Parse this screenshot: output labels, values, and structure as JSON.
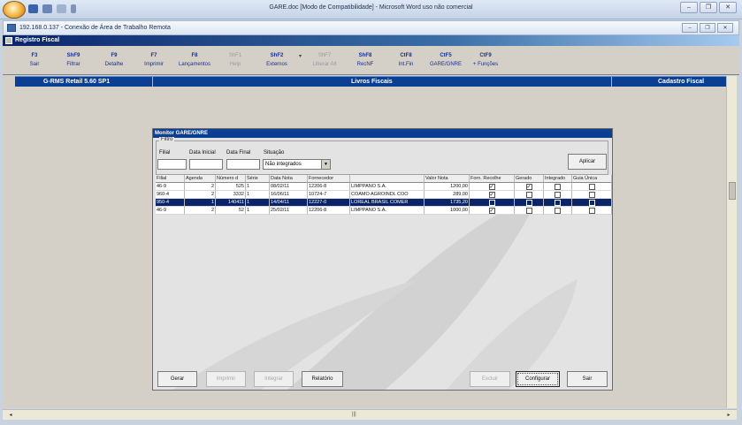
{
  "word": {
    "title": "GARE.doc [Modo de Compatibilidade] - Microsoft Word uso não comercial"
  },
  "rdp": {
    "title": "192.168.0.137 - Conexão de Área de Trabalho Remota"
  },
  "app": {
    "title": "Registro Fiscal"
  },
  "toolbar": {
    "items": [
      {
        "key": "F3",
        "label": "Sair",
        "enabled": true
      },
      {
        "key": "ShF9",
        "label": "Filtrar",
        "enabled": true
      },
      {
        "key": "F9",
        "label": "Detalhe",
        "enabled": true
      },
      {
        "key": "F7",
        "label": "Imprimir",
        "enabled": true
      },
      {
        "key": "F8",
        "label": "Lançamentos",
        "enabled": true
      },
      {
        "key": "ShF1",
        "label": "Help",
        "enabled": false
      },
      {
        "key": "ShF2",
        "label": "Externos",
        "enabled": true
      },
      {
        "key": "ShF7",
        "label": "Liberar Alt",
        "enabled": false
      },
      {
        "key": "ShF8",
        "label": "RecNF",
        "enabled": true
      },
      {
        "key": "CtF8",
        "label": "Int.Fin",
        "enabled": true
      },
      {
        "key": "CtF5",
        "label": "GARE/GNRE",
        "enabled": true
      },
      {
        "key": "CtF9",
        "label": "+ Funções",
        "enabled": true
      }
    ]
  },
  "infobar": {
    "left": "G-RMS Retail 5.60 SP1",
    "center": "Livros Fiscais",
    "right": "Cadastro Fiscal"
  },
  "dialog": {
    "title": "Monitor GARE/GNRE",
    "filter": {
      "legend": "Filtro",
      "filial_label": "Filial",
      "filial_value": "",
      "data_inicial_label": "Data Inicial",
      "data_inicial_value": "",
      "data_final_label": "Data Final",
      "data_final_value": "",
      "situacao_label": "Situação",
      "situacao_value": "Não integrados",
      "aplicar": "Aplicar"
    },
    "columns": [
      "Filial",
      "Agenda",
      "Número d",
      "Série",
      "Data Nota",
      "Fornecedor",
      "",
      "Valor Nota",
      "Forn. Recolhe",
      "Gerado",
      "Integrado",
      "Guia Única"
    ],
    "rows": [
      {
        "filial": "46-9",
        "agenda": "2",
        "numero": "525",
        "serie": "1",
        "data": "08/02/11",
        "forn_cod": "12206-8",
        "forn_nome": "LIMPPANO S.A.",
        "valor": "1200,00",
        "forn_recolhe": true,
        "gerado": true,
        "integrado": false,
        "guia_unica": false
      },
      {
        "filial": "960-4",
        "agenda": "2",
        "numero": "3332",
        "serie": "1",
        "data": "16/06/11",
        "forn_cod": "10724-7",
        "forn_nome": "COAMO AGROINDL COO",
        "valor": "289,00",
        "forn_recolhe": true,
        "gerado": false,
        "integrado": false,
        "guia_unica": false
      },
      {
        "filial": "950-4",
        "agenda": "1",
        "numero": "140411",
        "serie": "1",
        "data": "14/04/11",
        "forn_cod": "12227-0",
        "forn_nome": "LOREAL BRASIL COMER",
        "valor": "1735,20",
        "forn_recolhe": false,
        "gerado": false,
        "integrado": false,
        "guia_unica": false
      },
      {
        "filial": "46-9",
        "agenda": "2",
        "numero": "52",
        "serie": "1",
        "data": "25/02/11",
        "forn_cod": "12206-8",
        "forn_nome": "LIMPPANO S.A.",
        "valor": "1000,00",
        "forn_recolhe": true,
        "gerado": false,
        "integrado": false,
        "guia_unica": false
      }
    ],
    "selected_row": 2,
    "buttons": {
      "gerar": "Gerar",
      "imprimir": "Imprimir",
      "integrar": "Integrar",
      "relatorio": "Relatório",
      "excluir": "Excluir",
      "configurar": "Configurar",
      "sair": "Sair"
    }
  },
  "colors": {
    "title_blue": "#0a3f93",
    "selection": "#0a246a",
    "toolbar_text": "#1a2d8a"
  }
}
